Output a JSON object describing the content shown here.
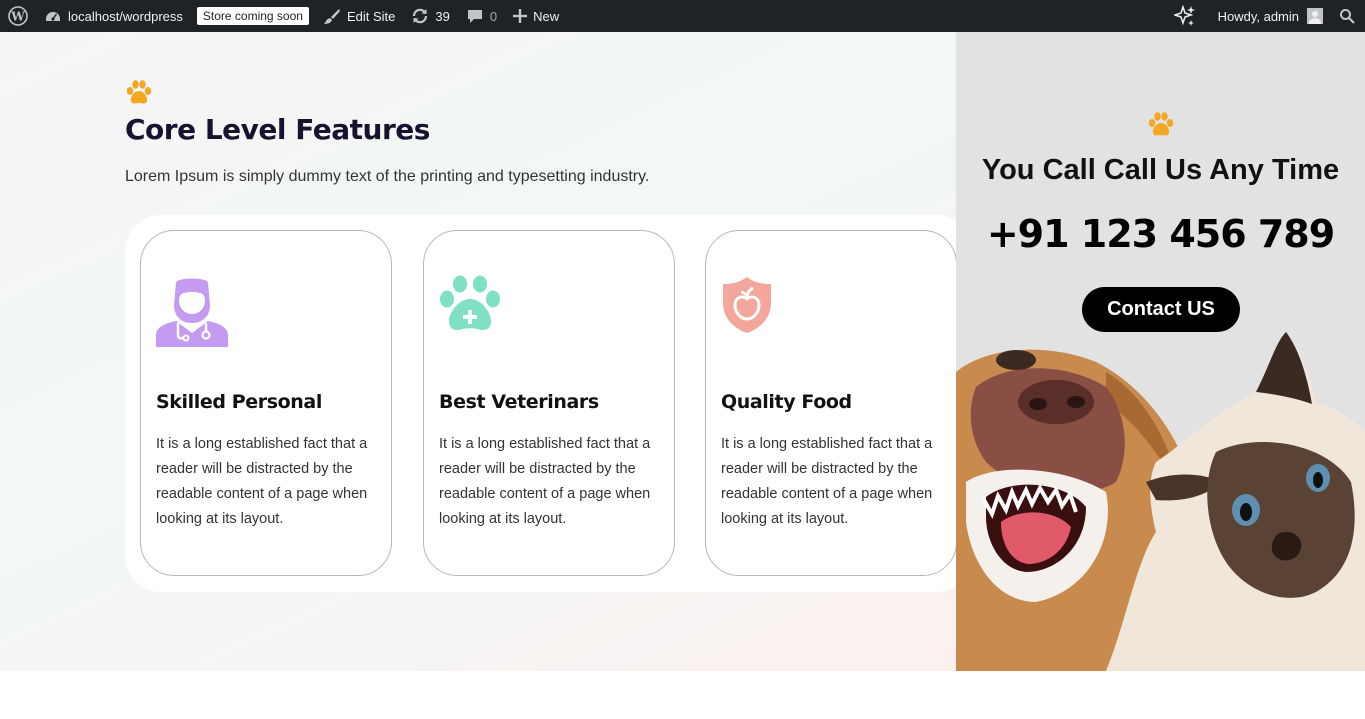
{
  "adminbar": {
    "site_name": "localhost/wordpress",
    "store_badge": "Store coming soon",
    "edit_site": "Edit Site",
    "updates_count": "39",
    "comments_count": "0",
    "new_label": "New",
    "howdy": "Howdy, admin"
  },
  "features": {
    "title": "Core Level Features",
    "lead": "Lorem Ipsum is simply dummy text of the printing and typesetting industry.",
    "cards": [
      {
        "title": "Skilled Personal",
        "text": "It is a long established fact that a reader will be distracted by the readable content of a page when looking at its layout.",
        "icon": "doctor-icon",
        "color": "#c49bf0"
      },
      {
        "title": "Best Veterinars",
        "text": "It is a long established fact that a reader will be distracted by the readable content of a page when looking at its layout.",
        "icon": "paw-plus-icon",
        "color": "#7fe0c3"
      },
      {
        "title": "Quality Food",
        "text": "It is a long established fact that a reader will be distracted by the readable content of a page when looking at its layout.",
        "icon": "shield-apple-icon",
        "color": "#f2a69c"
      }
    ]
  },
  "contact": {
    "title": "You Call Call Us Any Time",
    "phone": "+91 123 456 789",
    "button_label": "Contact US"
  },
  "colors": {
    "accent": "#f5a623",
    "adminbar_bg": "#1d2327",
    "button_bg": "#000000"
  }
}
